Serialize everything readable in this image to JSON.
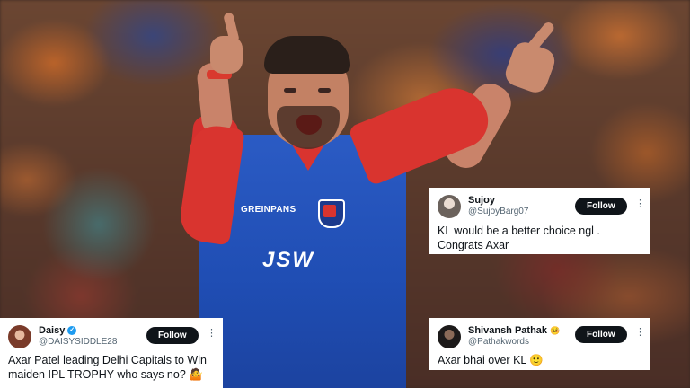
{
  "tweets": [
    {
      "name": "Sujoy",
      "handle": "@SujoyBarg07",
      "verified": false,
      "follow_label": "Follow",
      "more_icon": "more-vertical-icon",
      "text_lines": [
        "KL would be a better choice ngl .",
        "Congrats Axar"
      ]
    },
    {
      "name": "Shivansh Pathak",
      "name_emoji": "🤒",
      "handle": "@Pathakwords",
      "verified": false,
      "follow_label": "Follow",
      "more_icon": "more-vertical-icon",
      "text": "Axar bhai over KL",
      "text_emoji": "🙂"
    },
    {
      "name": "Daisy",
      "handle": "@DAISYSIDDLE28",
      "verified": true,
      "follow_label": "Follow",
      "more_icon": "more-vertical-icon",
      "text_lines": [
        "Axar Patel leading Delhi Capitals to Win",
        "maiden IPL TROPHY who says no?"
      ],
      "text_emoji": "🤷"
    }
  ],
  "jersey": {
    "sponsor": "GREINPANS",
    "chest_text": "JSW"
  },
  "colors": {
    "jersey_blue": "#1f4db3",
    "jersey_red": "#d9342f",
    "follow_button": "#0f1419",
    "verified_blue": "#1d9bf0"
  }
}
